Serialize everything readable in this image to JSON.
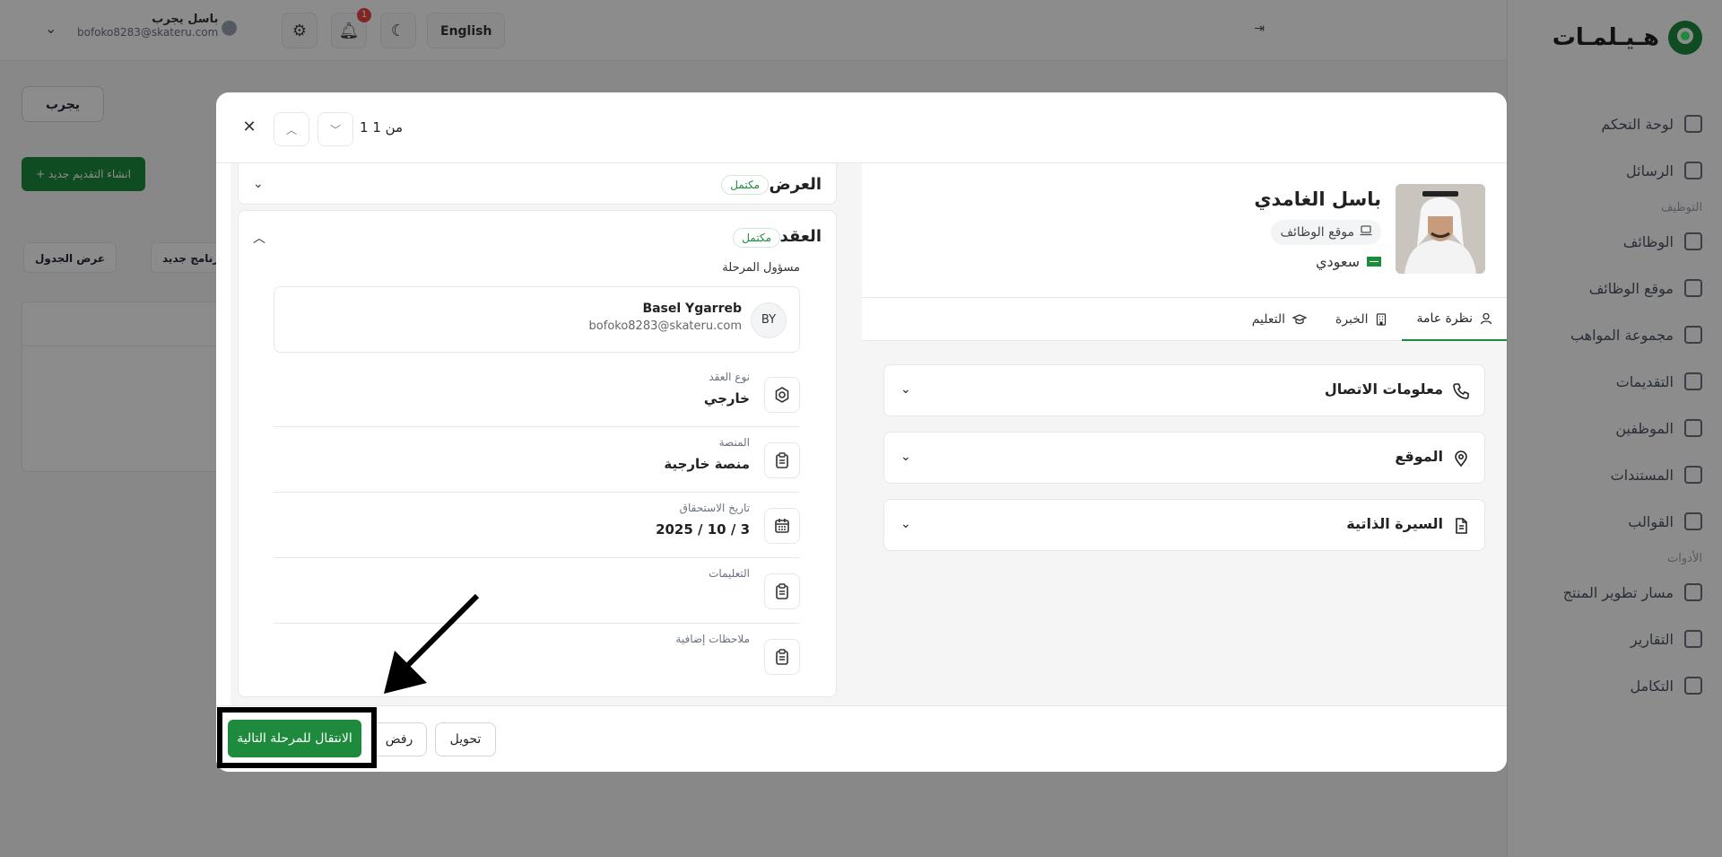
{
  "app": {
    "brand_name": "هـيـلمـات",
    "collapse_icon": "⇥",
    "sidebar": {
      "items_top": [
        {
          "label": "لوحة التحكم",
          "icon": "dashboard-icon"
        },
        {
          "label": "الرسائل",
          "icon": "mail-icon"
        }
      ],
      "section_jobs": "التوظيف",
      "items_jobs": [
        {
          "label": "الوظائف",
          "icon": "briefcase-icon"
        },
        {
          "label": "موقع الوظائف",
          "icon": "monitor-icon"
        },
        {
          "label": "مجموعة المواهب",
          "icon": "talent-icon"
        },
        {
          "label": "التقديمات",
          "icon": "applications-icon"
        },
        {
          "label": "الموظفين",
          "icon": "user-icon"
        },
        {
          "label": "المستندات",
          "icon": "document-icon"
        },
        {
          "label": "القوالب",
          "icon": "template-icon"
        }
      ],
      "section_tools": "الأدوات",
      "items_tools": [
        {
          "label": "مسار تطوير المنتج",
          "icon": "path-icon"
        },
        {
          "label": "التقارير",
          "icon": "report-icon"
        },
        {
          "label": "التكامل",
          "icon": "integration-icon"
        }
      ]
    },
    "topbar": {
      "language": "English",
      "notification_count": "1",
      "user_name": "باسل يجرب",
      "user_email": "bofoko8283@skateru.com"
    },
    "page": {
      "try_button": "يجرب",
      "create_button": "+ انشاء التقديم جديد",
      "chip_table_view": "عرض الجدول",
      "chip_new_program": "برنامج جديد"
    }
  },
  "modal": {
    "pager": "1 من 1",
    "offer_card": {
      "title": "العرض",
      "status": "مكتمل"
    },
    "contract_card": {
      "title": "العقد",
      "status": "مكتمل",
      "stage_owner_label": "مسؤول المرحلة",
      "owner": {
        "initials": "BY",
        "name": "Basel Ygarreb",
        "email": "bofoko8283@skateru.com"
      },
      "fields": [
        {
          "label": "نوع العقد",
          "value": "خارجي",
          "icon": "settings-icon"
        },
        {
          "label": "المنصة",
          "value": "منصة خارجية",
          "icon": "clipboard-icon"
        },
        {
          "label": "تاريخ الاستحقاق",
          "value": "3 / 10 / 2025",
          "icon": "calendar-icon"
        },
        {
          "label": "التعليمات",
          "value": "",
          "icon": "clipboard-icon"
        },
        {
          "label": "ملاحظات إضافية",
          "value": "",
          "icon": "clipboard-icon"
        }
      ]
    },
    "candidate": {
      "name": "باسل الغامدي",
      "source": "موقع الوظائف",
      "nationality": "سعودي"
    },
    "tabs": [
      {
        "label": "نظرة عامة",
        "icon": "user-icon"
      },
      {
        "label": "الخبرة",
        "icon": "building-icon"
      },
      {
        "label": "التعليم",
        "icon": "graduation-cap-icon"
      }
    ],
    "accordions": [
      {
        "label": "معلومات الاتصال",
        "icon": "phone-icon"
      },
      {
        "label": "الموقع",
        "icon": "location-pin-icon"
      },
      {
        "label": "السيرة الذاتية",
        "icon": "document-icon"
      }
    ],
    "footer": {
      "next_stage": "الانتقال للمرحلة التالية",
      "reject": "رفض",
      "transfer": "تحويل"
    }
  },
  "colors": {
    "brand_green": "#1e8a3c",
    "overlay": "rgba(0,0,0,0.45)"
  }
}
